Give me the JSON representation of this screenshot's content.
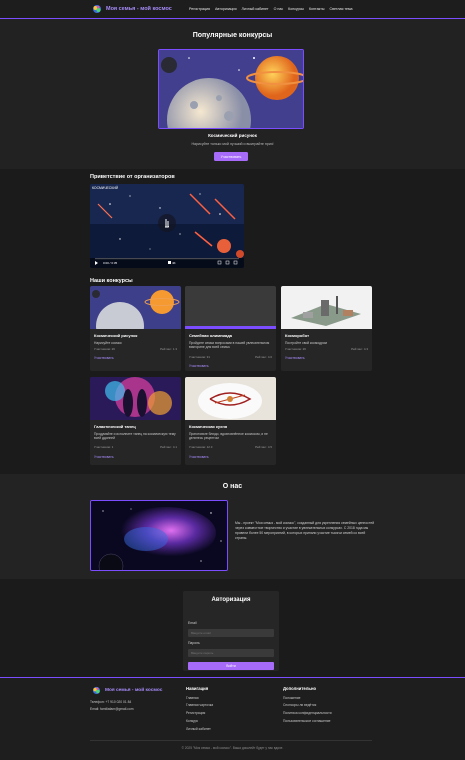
{
  "header": {
    "logo_text": "Моя семья - мой космос",
    "nav": [
      "Регистрация",
      "Авторизация",
      "Личный кабинет",
      "О нас",
      "Конкурсы",
      "Контакты",
      "Светлая тема"
    ]
  },
  "popular": {
    "title": "Популярные конкурсы",
    "item_name": "Космический рисунок",
    "item_desc": "Нарисуйте только мой лучший и выиграйте приз!",
    "button": "Участвовать"
  },
  "greeting": {
    "title": "Приветствие от организаторов",
    "video_label": "КОСМИЧЕСКИЙ",
    "time": "0:00 / 0:35",
    "quality": "4K"
  },
  "contests": {
    "title": "Наши конкурсы",
    "cards": [
      {
        "title": "Космический рисунок",
        "desc": "Нарисуйте космос",
        "participants": "Участников: 26",
        "rating": "Рейтинг: 1.3",
        "link": "Участвовать"
      },
      {
        "title": "Семейная олимпиада",
        "desc": "Пройдите семьи вопросами в нашей увлекательном викторине для всей семьи.",
        "participants": "Участников: 31",
        "rating": "Рейтинг: 4.0",
        "link": "Участвовать"
      },
      {
        "title": "Косморобот",
        "desc": "Постройте свой космодром",
        "participants": "Участников: 26",
        "rating": "Рейтинг: 4.3",
        "link": "Участвовать"
      },
      {
        "title": "Галактический танец",
        "desc": "Продумайте и исполните танец на космическую тему всей ддонней",
        "participants": "Участников: 1",
        "rating": "Рейтинг: 4.1",
        "link": "Участвовать"
      },
      {
        "title": "Космическая кухня",
        "desc": "Приготовьте блюдо, вдохновлённое космосом, и не делитесь рецептом",
        "participants": "Участников: 12.3",
        "rating": "Рейтинг: 4.5",
        "link": "Участвовать"
      }
    ]
  },
  "about": {
    "title": "О нас",
    "text": "Мы - проект \"Моя семья - мой космос\", созданный для укрепления семейных ценностей через совместное творчество и участие в увлекательных конкурсах. С 2018 года мы провели более 50 мероприятий, в которых приняли участие тысячи семей со всей страны."
  },
  "auth": {
    "title": "Авторизация",
    "email_label": "Email",
    "email_placeholder": "Введите email",
    "password_label": "Пароль",
    "password_placeholder": "Введите пароль",
    "button": "Войти"
  },
  "footer": {
    "logo_text": "Моя семья - мой космос",
    "phone": "Телефон: +7 910 020 01 84",
    "email": "Email: familiafam@gmail.com",
    "nav_title": "Навигация",
    "nav_links": [
      "Главная",
      "Главная чарточка",
      "Регистрация",
      "Конкурс",
      "Личный кабинет"
    ],
    "extra_title": "Дополнительно",
    "extra_links": [
      "Положение",
      "Спонсоры ли ведётся",
      "Политика конфиденциальности",
      "Пользовательское соглашение"
    ],
    "copyright": "© 2025 \"Моя семья - мой космос\". Ваша дисклейт будет у нас вдохе."
  },
  "colors": {
    "accent": "#a76bfa",
    "border": "#7c4dff",
    "bg": "#1a1a1a"
  }
}
